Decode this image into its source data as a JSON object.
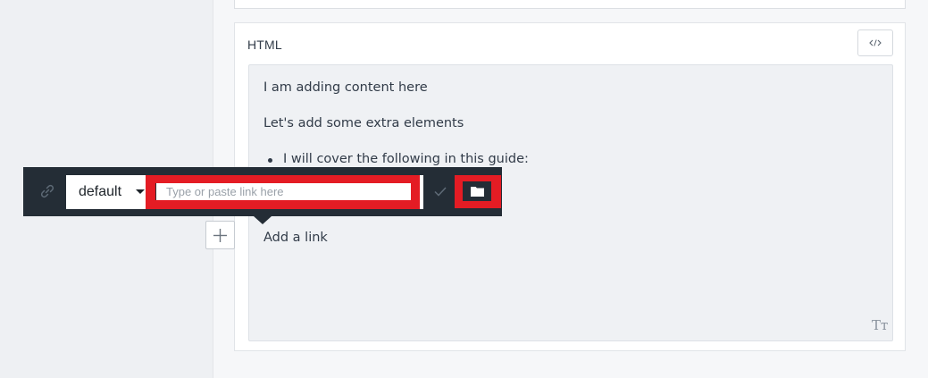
{
  "card": {
    "title": "HTML",
    "code_icon": "code-icon"
  },
  "editor": {
    "paragraphs": [
      "I am adding content here",
      "Let's add some extra elements"
    ],
    "bullet": "I will cover the following in this guide:",
    "link_paragraph": "Add a link",
    "format_icon_text": "Tт"
  },
  "toolbar": {
    "link_icon": "link-icon",
    "style_select_value": "default",
    "link_placeholder": "Type or paste link here",
    "confirm_icon": "check-icon",
    "browse_icon": "folder-icon"
  },
  "add_block_icon": "plus-icon",
  "colors": {
    "toolbar_bg": "#242d36",
    "highlight_red": "#e41c24",
    "editor_bg": "#eff1f4"
  }
}
